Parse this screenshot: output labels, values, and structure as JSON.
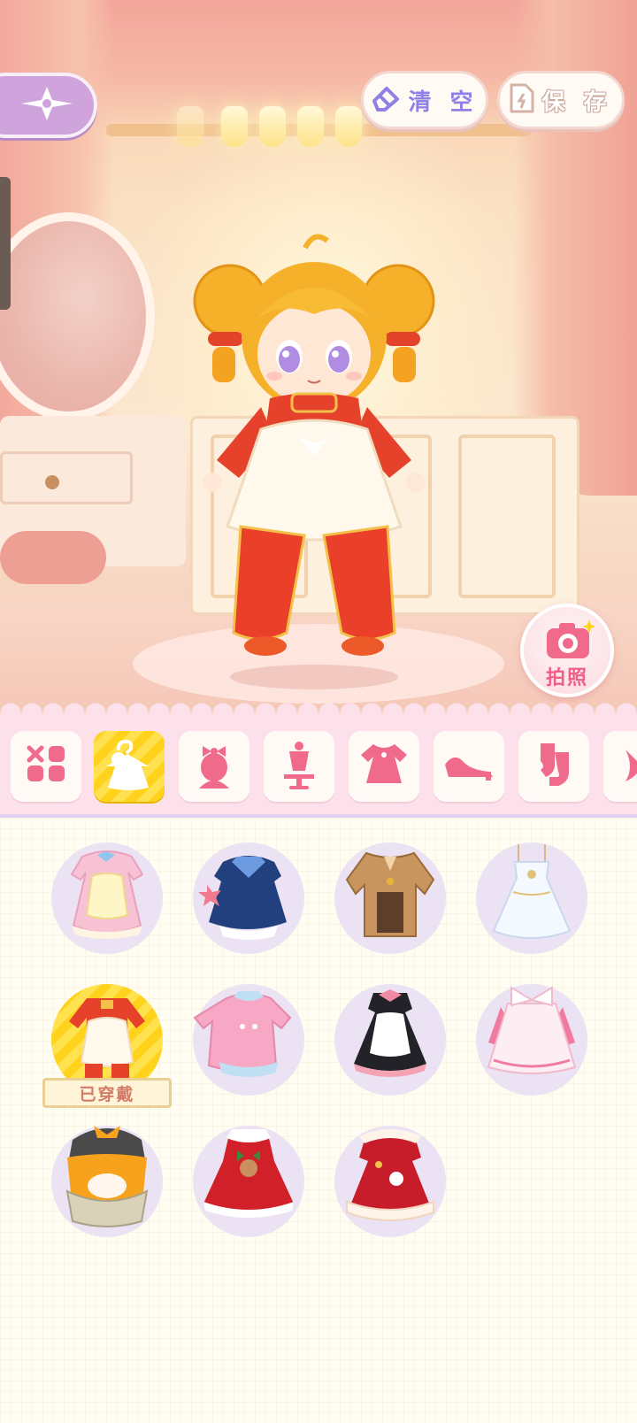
{
  "top_bar": {
    "back_icon": "sparkle-star-icon",
    "help_icon": "question-icon",
    "help_glyph": "?",
    "clear_label": "清 空",
    "clear_icon": "eraser-icon",
    "save_label": "保 存",
    "save_icon": "document-icon"
  },
  "photo_button": {
    "label": "拍照",
    "icon": "camera-icon"
  },
  "categories": [
    {
      "id": "all",
      "icon": "grid-icon"
    },
    {
      "id": "outfit",
      "icon": "hanger-dress-icon",
      "active": true
    },
    {
      "id": "headwear",
      "icon": "bow-bust-icon"
    },
    {
      "id": "accessory",
      "icon": "mannequin-icon"
    },
    {
      "id": "dress",
      "icon": "dress-icon"
    },
    {
      "id": "shoes",
      "icon": "shoes-icon"
    },
    {
      "id": "socks",
      "icon": "socks-icon"
    },
    {
      "id": "more",
      "icon": "partial-icon"
    }
  ],
  "items": {
    "worn_label": "已穿戴",
    "list": [
      {
        "name": "pink-apron-dress",
        "worn": false
      },
      {
        "name": "navy-sailor-dress",
        "worn": false
      },
      {
        "name": "brown-trench-coat",
        "worn": false
      },
      {
        "name": "white-gown",
        "worn": false
      },
      {
        "name": "red-qipao-apron",
        "worn": true
      },
      {
        "name": "pink-pajama",
        "worn": false
      },
      {
        "name": "black-maid-dress",
        "worn": false
      },
      {
        "name": "pink-bow-dress",
        "worn": false
      },
      {
        "name": "orange-duck-outfit",
        "worn": false
      },
      {
        "name": "red-christmas-dress",
        "worn": false
      },
      {
        "name": "red-lunar-dress",
        "worn": false
      }
    ]
  },
  "colors": {
    "accent_yellow": "#ffd21c",
    "lavender": "#cfa4dc",
    "pink_bar": "#fde1ea",
    "icon_pink": "#f06a8c"
  }
}
